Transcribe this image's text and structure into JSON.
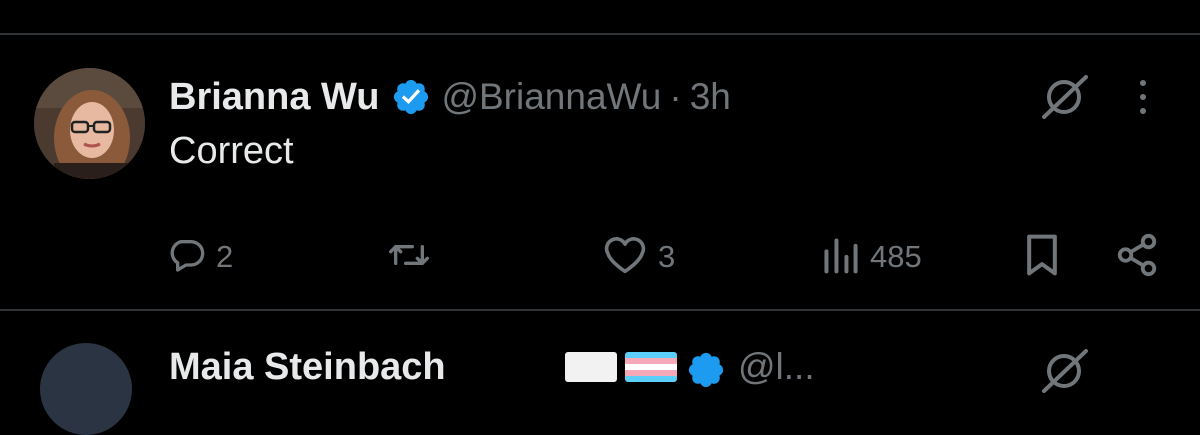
{
  "tweet": {
    "author": {
      "display_name": "Brianna Wu",
      "handle": "@BriannaWu",
      "verified": true,
      "avatar": "profile-photo"
    },
    "separator": "·",
    "time": "3h",
    "text": "Correct",
    "actions": {
      "reply": {
        "icon": "reply-icon",
        "count": "2"
      },
      "retweet": {
        "icon": "retweet-icon",
        "count": ""
      },
      "like": {
        "icon": "heart-icon",
        "count": "3"
      },
      "views": {
        "icon": "views-icon",
        "count": "485"
      },
      "bookmark": {
        "icon": "bookmark-icon"
      },
      "share": {
        "icon": "share-icon"
      }
    },
    "header_icons": [
      "grok-icon",
      "more-icon"
    ]
  },
  "next_tweet": {
    "display_name_partial": "Maia Steinbach",
    "flags": [
      "white-flag",
      "transgender-flag"
    ],
    "verified": true,
    "handle_partial": "@l..."
  },
  "colors": {
    "background": "#000000",
    "primary_text": "#e7e9ea",
    "secondary_text": "#71767b",
    "divider": "#2f3336",
    "verified_blue": "#1d9bf0"
  }
}
